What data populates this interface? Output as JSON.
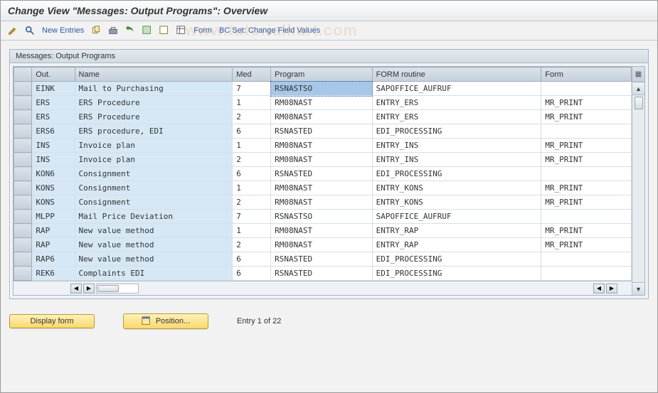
{
  "title": "Change View \"Messages: Output Programs\": Overview",
  "toolbar": {
    "new_entries": "New Entries",
    "form": "Form",
    "bcset": "BC Set: Change Field Values"
  },
  "panel": {
    "title": "Messages: Output Programs"
  },
  "columns": [
    "Out.",
    "Name",
    "Med",
    "Program",
    "FORM routine",
    "Form"
  ],
  "rows": [
    {
      "out": "EINK",
      "name": "Mail to Purchasing",
      "med": "7",
      "program": "RSNASTSO",
      "routine": "SAPOFFICE_AUFRUF",
      "form": ""
    },
    {
      "out": "ERS",
      "name": "ERS Procedure",
      "med": "1",
      "program": "RM08NAST",
      "routine": "ENTRY_ERS",
      "form": "MR_PRINT"
    },
    {
      "out": "ERS",
      "name": "ERS Procedure",
      "med": "2",
      "program": "RM08NAST",
      "routine": "ENTRY_ERS",
      "form": "MR_PRINT"
    },
    {
      "out": "ERS6",
      "name": "ERS procedure, EDI",
      "med": "6",
      "program": "RSNASTED",
      "routine": "EDI_PROCESSING",
      "form": ""
    },
    {
      "out": "INS",
      "name": "Invoice plan",
      "med": "1",
      "program": "RM08NAST",
      "routine": "ENTRY_INS",
      "form": "MR_PRINT"
    },
    {
      "out": "INS",
      "name": "Invoice plan",
      "med": "2",
      "program": "RM08NAST",
      "routine": "ENTRY_INS",
      "form": "MR_PRINT"
    },
    {
      "out": "KON6",
      "name": "Consignment",
      "med": "6",
      "program": "RSNASTED",
      "routine": "EDI_PROCESSING",
      "form": ""
    },
    {
      "out": "KONS",
      "name": "Consignment",
      "med": "1",
      "program": "RM08NAST",
      "routine": "ENTRY_KONS",
      "form": "MR_PRINT"
    },
    {
      "out": "KONS",
      "name": "Consignment",
      "med": "2",
      "program": "RM08NAST",
      "routine": "ENTRY_KONS",
      "form": "MR_PRINT"
    },
    {
      "out": "MLPP",
      "name": "Mail Price Deviation",
      "med": "7",
      "program": "RSNASTSO",
      "routine": "SAPOFFICE_AUFRUF",
      "form": ""
    },
    {
      "out": "RAP",
      "name": "New value method",
      "med": "1",
      "program": "RM08NAST",
      "routine": "ENTRY_RAP",
      "form": "MR_PRINT"
    },
    {
      "out": "RAP",
      "name": "New value method",
      "med": "2",
      "program": "RM08NAST",
      "routine": "ENTRY_RAP",
      "form": "MR_PRINT"
    },
    {
      "out": "RAP6",
      "name": "New value method",
      "med": "6",
      "program": "RSNASTED",
      "routine": "EDI_PROCESSING",
      "form": ""
    },
    {
      "out": "REK6",
      "name": "Complaints EDI",
      "med": "6",
      "program": "RSNASTED",
      "routine": "EDI_PROCESSING",
      "form": ""
    }
  ],
  "selected_cell": {
    "row": 0,
    "col": "program"
  },
  "footer": {
    "display_form": "Display form",
    "position": "Position...",
    "status": "Entry 1 of 22"
  }
}
